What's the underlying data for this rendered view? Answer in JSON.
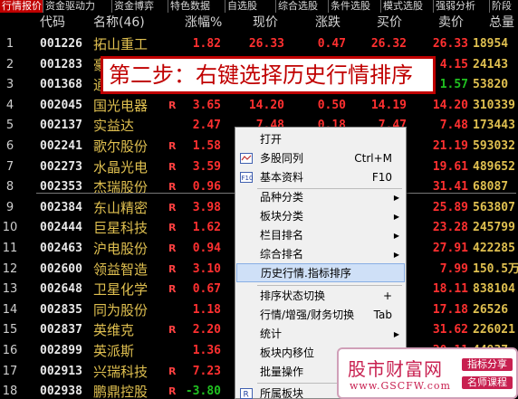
{
  "tabs": [
    "行情报价",
    "资金驱动力",
    "资金博弈",
    "特色数据",
    "自选股",
    "综合选股",
    "条件选股",
    "模式选股",
    "强弱分析",
    "阶段"
  ],
  "columns": {
    "code": "代码",
    "name": "名称(46)",
    "pct": "涨幅%",
    "price": "现价",
    "chg": "涨跌",
    "buy": "买价",
    "sell": "卖价",
    "vol": "总量"
  },
  "rows": [
    {
      "idx": "1",
      "code": "001226",
      "name": "拓山重工",
      "flag": "",
      "pct": "1.82",
      "price": "26.33",
      "chg": "0.47",
      "buy": "26.32",
      "sell": "26.33",
      "vol": "18954"
    },
    {
      "idx": "2",
      "code": "001283",
      "name": "豪",
      "flag": "",
      "pct": "",
      "price": "",
      "chg": "",
      "buy": "",
      "sell": "4.15",
      "vol": "24143"
    },
    {
      "idx": "3",
      "code": "001368",
      "name": "通",
      "flag": "",
      "pct": "",
      "price": "",
      "chg": "",
      "buy": "",
      "sell": "1.57",
      "vol": "53820"
    },
    {
      "idx": "4",
      "code": "002045",
      "name": "国光电器",
      "flag": "R",
      "pct": "3.65",
      "price": "14.20",
      "chg": "0.50",
      "buy": "14.19",
      "sell": "14.20",
      "vol": "310339"
    },
    {
      "idx": "5",
      "code": "002137",
      "name": "实益达",
      "flag": "",
      "pct": "2.47",
      "price": "7.48",
      "chg": "0.18",
      "buy": "7.47",
      "sell": "7.48",
      "vol": "173443"
    },
    {
      "idx": "6",
      "code": "002241",
      "name": "歌尔股份",
      "flag": "R",
      "pct": "1.58",
      "price": "",
      "chg": "",
      "buy": "",
      "sell": "21.19",
      "vol": "593032"
    },
    {
      "idx": "7",
      "code": "002273",
      "name": "水晶光电",
      "flag": "R",
      "pct": "3.59",
      "price": "",
      "chg": "",
      "buy": "",
      "sell": "19.61",
      "vol": "489652"
    },
    {
      "idx": "8",
      "code": "002353",
      "name": "杰瑞股份",
      "flag": "R",
      "pct": "0.96",
      "price": "",
      "chg": "",
      "buy": "",
      "sell": "31.41",
      "vol": "68087"
    },
    {
      "idx": "9",
      "code": "002384",
      "name": "东山精密",
      "flag": "R",
      "pct": "3.98",
      "price": "",
      "chg": "",
      "buy": "",
      "sell": "25.89",
      "vol": "563807"
    },
    {
      "idx": "10",
      "code": "002444",
      "name": "巨星科技",
      "flag": "R",
      "pct": "1.62",
      "price": "",
      "chg": "",
      "buy": "",
      "sell": "23.28",
      "vol": "245799"
    },
    {
      "idx": "11",
      "code": "002463",
      "name": "沪电股份",
      "flag": "R",
      "pct": "0.94",
      "price": "",
      "chg": "",
      "buy": "",
      "sell": "27.91",
      "vol": "422285"
    },
    {
      "idx": "12",
      "code": "002600",
      "name": "领益智造",
      "flag": "R",
      "pct": "3.10",
      "price": "",
      "chg": "",
      "buy": "",
      "sell": "7.99",
      "vol": "150.5万"
    },
    {
      "idx": "13",
      "code": "002648",
      "name": "卫星化学",
      "flag": "R",
      "pct": "0.67",
      "price": "",
      "chg": "",
      "buy": "",
      "sell": "18.11",
      "vol": "838104"
    },
    {
      "idx": "14",
      "code": "002835",
      "name": "同为股份",
      "flag": "",
      "pct": "1.18",
      "price": "",
      "chg": "",
      "buy": "",
      "sell": "17.18",
      "vol": "26526"
    },
    {
      "idx": "15",
      "code": "002837",
      "name": "英维克",
      "flag": "R",
      "pct": "2.20",
      "price": "",
      "chg": "",
      "buy": "",
      "sell": "31.62",
      "vol": "226021"
    },
    {
      "idx": "16",
      "code": "002899",
      "name": "英派斯",
      "flag": "",
      "pct": "1.36",
      "price": "",
      "chg": "",
      "buy": "",
      "sell": "20.11",
      "vol": "44937"
    },
    {
      "idx": "17",
      "code": "002913",
      "name": "兴瑞科技",
      "flag": "R",
      "pct": "7.23",
      "price": "",
      "chg": "",
      "buy": "",
      "sell": "",
      "vol": ""
    },
    {
      "idx": "18",
      "code": "002938",
      "name": "鹏鼎控股",
      "flag": "R",
      "pct": "-3.80",
      "price": "",
      "chg": "",
      "buy": "",
      "sell": "",
      "vol": ""
    }
  ],
  "banner": "第二步：右键选择历史行情排序",
  "menu": {
    "items": [
      {
        "label": "打开",
        "shortcut": "",
        "submenu": false,
        "icon": ""
      },
      {
        "label": "多股同列",
        "shortcut": "Ctrl+M",
        "submenu": false,
        "icon": "multi-chart-icon"
      },
      {
        "label": "基本资料",
        "shortcut": "F10",
        "submenu": false,
        "icon": "f10-info-icon"
      },
      {
        "label": "品种分类",
        "shortcut": "",
        "submenu": true,
        "icon": ""
      },
      {
        "label": "板块分类",
        "shortcut": "",
        "submenu": true,
        "icon": ""
      },
      {
        "label": "栏目排名",
        "shortcut": "",
        "submenu": true,
        "icon": ""
      },
      {
        "label": "综合排名",
        "shortcut": "",
        "submenu": true,
        "icon": ""
      },
      {
        "label": "历史行情.指标排序",
        "shortcut": "",
        "submenu": false,
        "icon": ""
      },
      {
        "label": "排序状态切换",
        "shortcut": "+",
        "submenu": false,
        "icon": ""
      },
      {
        "label": "行情/增强/财务切换",
        "shortcut": "Tab",
        "submenu": false,
        "icon": ""
      },
      {
        "label": "统计",
        "shortcut": "",
        "submenu": true,
        "icon": ""
      },
      {
        "label": "板块内移位",
        "shortcut": "",
        "submenu": true,
        "icon": ""
      },
      {
        "label": "批量操作",
        "shortcut": "",
        "submenu": false,
        "icon": ""
      },
      {
        "label": "所属板块",
        "shortcut": "",
        "submenu": false,
        "icon": "r-block-icon"
      }
    ]
  },
  "watermark": {
    "title": "股市财富网",
    "url": "www.GSCFW.com",
    "badge1": "指标分享",
    "badge2": "名师课程"
  },
  "colors": {
    "up": "#ff3030",
    "down": "#20c020",
    "name": "#e0c050",
    "active_tab": "#c00000",
    "menu_highlight": "#cfe0f7"
  }
}
